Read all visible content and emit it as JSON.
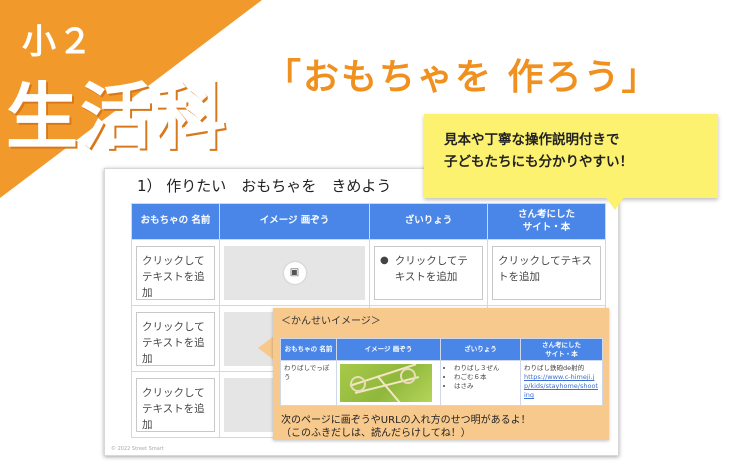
{
  "header": {
    "grade": "小２",
    "subject": "生活科",
    "lesson_title": "「おもちゃを 作ろう」",
    "accent_color": "#f19a2b"
  },
  "callout": {
    "line1": "見本や丁寧な操作説明付きで",
    "line2": "子どもたちにも分かりやすい！"
  },
  "slide": {
    "heading": "1） 作りたい　おもちゃを　きめよう",
    "copyright": "© 2022 Street Smart",
    "columns": [
      "おもちゃの 名前",
      "イメージ 画ぞう",
      "ざいりょう",
      "さん考にした\nサイト・本"
    ],
    "placeholder_text": "クリックしてテキストを追加",
    "image_icon": "image-icon",
    "header_color": "#4a86e8"
  },
  "sample": {
    "title": "＜かんせいイメージ＞",
    "columns": [
      "おもちゃの 名前",
      "イメージ 画ぞう",
      "ざいりょう",
      "さん考にした\nサイト・本"
    ],
    "toy_name": "わりばしでっぽう",
    "materials": [
      "わりばし３ぜん",
      "わごむ６本",
      "はさみ"
    ],
    "reference_title": "わりばし鉄砲de射的",
    "reference_url": "https://www.c-himeji.jp/kids/stayhome/shooting",
    "note_line1": "次のページに画ぞうやURLの入れ方のせつ明があるよ！",
    "note_line2": "（このふきだしは、読んだらけしてね！）"
  }
}
